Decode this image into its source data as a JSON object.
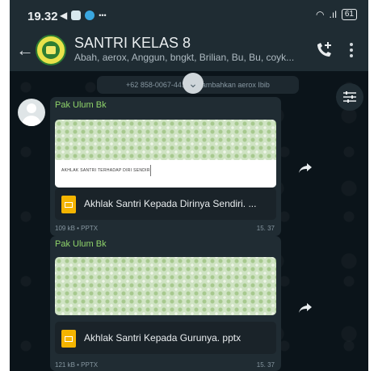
{
  "status_bar": {
    "time": "19.32",
    "icons": [
      "navigation-icon",
      "gallery-icon",
      "messenger-icon",
      "extra-icon"
    ],
    "battery": "61"
  },
  "header": {
    "title": "SANTRI KELAS 8",
    "subtitle": "Abah, aerox, Anggun, bngkt, Brilian, Bu, Bu, coyk..."
  },
  "system_message": "+62 858-0067-441 menambahkan aerox Ibib",
  "messages": [
    {
      "sender": "Pak Ulum Bk",
      "preview_caption": "AKHLAK SANTRI TERHADAP DIRI SENDIRI",
      "file_name": "Akhlak Santri Kepada Dirinya Sendiri. ...",
      "meta": "109 kB • PPTX",
      "time": "15. 37"
    },
    {
      "sender": "Pak Ulum Bk",
      "preview_caption": "",
      "file_name": "Akhlak Santri Kepada Gurunya. pptx",
      "meta": "121 kB • PPTX",
      "time": "15. 37"
    }
  ],
  "colors": {
    "chat_background": "#0b141a",
    "header_background": "#1f2c33",
    "bubble": "#202c33",
    "sender_name": "#8fd36a",
    "doc_icon": "#f4b400"
  }
}
